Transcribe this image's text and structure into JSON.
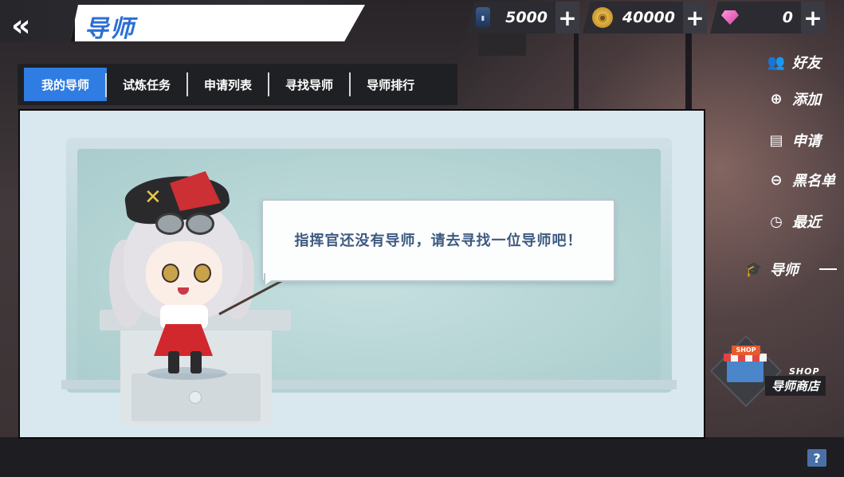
{
  "header": {
    "back_icon": "double-chevron-left-icon",
    "title": "导师"
  },
  "currencies": [
    {
      "icon": "fuel-barrel-icon",
      "value": "5000",
      "color": "#3c5a8a"
    },
    {
      "icon": "gold-coin-icon",
      "value": "40000",
      "color": "#e0b040"
    },
    {
      "icon": "gem-icon",
      "value": "0",
      "color": "#e35fb8"
    }
  ],
  "tabs": [
    {
      "label": "我的导师",
      "active": true
    },
    {
      "label": "试炼任务",
      "active": false
    },
    {
      "label": "申请列表",
      "active": false
    },
    {
      "label": "寻找导师",
      "active": false
    },
    {
      "label": "导师排行",
      "active": false
    }
  ],
  "main": {
    "message": "指挥官还没有导师，请去寻找一位导师吧！"
  },
  "side_menu": [
    {
      "icon": "friends-icon",
      "label": "好友"
    },
    {
      "icon": "add-friend-icon",
      "label": "添加"
    },
    {
      "icon": "application-doc-icon",
      "label": "申请"
    },
    {
      "icon": "blacklist-icon",
      "label": "黑名单"
    },
    {
      "icon": "recent-icon",
      "label": "最近"
    },
    {
      "icon": "graduation-cap-icon",
      "label": "导师"
    }
  ],
  "shop": {
    "sign": "SHOP",
    "english_label": "SHOP",
    "label": "导师商店"
  },
  "help": {
    "label": "?"
  },
  "colors": {
    "accent_blue": "#2f7de2",
    "title_blue": "#2a6fd6",
    "message_text": "#3d5a80"
  }
}
